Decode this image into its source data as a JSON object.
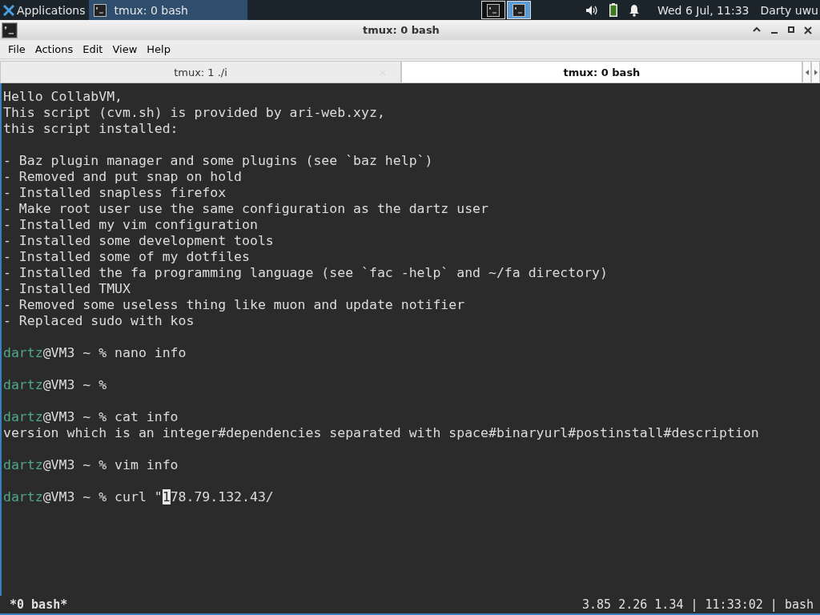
{
  "taskbar": {
    "apps_label": "Applications",
    "tasks": [
      {
        "label": "tmux: 0 bash",
        "selected": true
      }
    ],
    "workspaces": [
      {
        "selected": false
      },
      {
        "selected": true
      }
    ],
    "clock": "Wed  6 Jul, 11:33",
    "user": "Darty uwu"
  },
  "window": {
    "title": "tmux: 0 bash"
  },
  "menu": [
    "File",
    "Actions",
    "Edit",
    "View",
    "Help"
  ],
  "tabs": [
    {
      "label": "tmux: 1 ./i",
      "selected": false
    },
    {
      "label": "tmux: 0 bash",
      "selected": true
    }
  ],
  "terminal": {
    "lines": [
      {
        "kind": "text",
        "text": "Hello CollabVM,"
      },
      {
        "kind": "text",
        "text": "This script (cvm.sh) is provided by ari-web.xyz,"
      },
      {
        "kind": "text",
        "text": "this script installed:"
      },
      {
        "kind": "blank"
      },
      {
        "kind": "text",
        "text": "- Baz plugin manager and some plugins (see `baz help`)"
      },
      {
        "kind": "text",
        "text": "- Removed and put snap on hold"
      },
      {
        "kind": "text",
        "text": "- Installed snapless firefox"
      },
      {
        "kind": "text",
        "text": "- Make root user use the same configuration as the dartz user"
      },
      {
        "kind": "text",
        "text": "- Installed my vim configuration"
      },
      {
        "kind": "text",
        "text": "- Installed some development tools"
      },
      {
        "kind": "text",
        "text": "- Installed some of my dotfiles"
      },
      {
        "kind": "text",
        "text": "- Installed the fa programming language (see `fac -help` and ~/fa directory)"
      },
      {
        "kind": "text",
        "text": "- Installed TMUX"
      },
      {
        "kind": "text",
        "text": "- Removed some useless thing like muon and update notifier"
      },
      {
        "kind": "text",
        "text": "- Replaced sudo with kos"
      },
      {
        "kind": "blank"
      },
      {
        "kind": "prompt",
        "user": "dartz",
        "rest": "@VM3 ~ % nano info"
      },
      {
        "kind": "blank"
      },
      {
        "kind": "prompt",
        "user": "dartz",
        "rest": "@VM3 ~ %"
      },
      {
        "kind": "blank"
      },
      {
        "kind": "prompt",
        "user": "dartz",
        "rest": "@VM3 ~ % cat info"
      },
      {
        "kind": "text",
        "text": "version which is an integer#dependencies separated with space#binaryurl#postinstall#description"
      },
      {
        "kind": "blank"
      },
      {
        "kind": "prompt",
        "user": "dartz",
        "rest": "@VM3 ~ % vim info"
      },
      {
        "kind": "blank"
      },
      {
        "kind": "prompt",
        "user": "dartz",
        "rest": "@VM3 ~ % curl \"",
        "cursor": "1",
        "after": "78.79.132.43/"
      }
    ]
  },
  "status_bar": {
    "left": "*0 bash*",
    "right": "3.85 2.26 1.34 | 11:33:02 | bash"
  }
}
